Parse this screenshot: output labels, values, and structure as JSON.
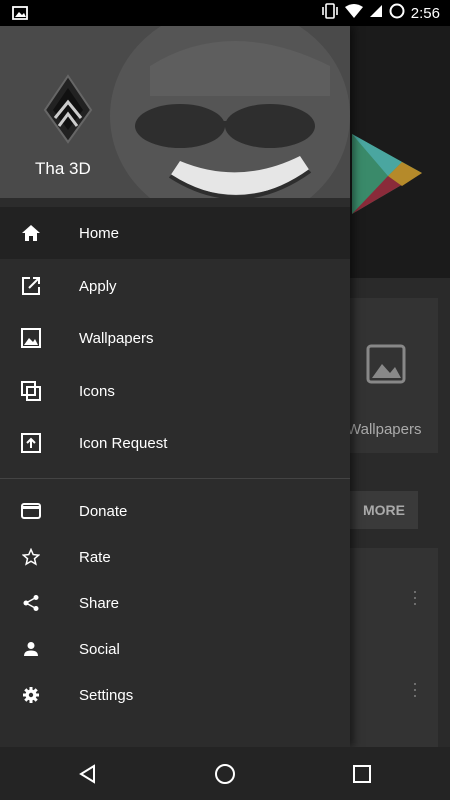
{
  "status": {
    "time": "2:56"
  },
  "drawer": {
    "title": "Tha 3D",
    "main_items": [
      {
        "label": "Home",
        "icon": "home-icon"
      },
      {
        "label": "Apply",
        "icon": "open-in-new-icon"
      },
      {
        "label": "Wallpapers",
        "icon": "image-icon"
      },
      {
        "label": "Icons",
        "icon": "copy-icon"
      },
      {
        "label": "Icon Request",
        "icon": "upload-icon"
      }
    ],
    "secondary_items": [
      {
        "label": "Donate",
        "icon": "card-icon"
      },
      {
        "label": "Rate",
        "icon": "star-icon"
      },
      {
        "label": "Share",
        "icon": "share-icon"
      },
      {
        "label": "Social",
        "icon": "person-icon"
      },
      {
        "label": "Settings",
        "icon": "gear-icon"
      }
    ]
  },
  "background": {
    "card_label": "Wallpapers",
    "more_label": "MORE"
  }
}
